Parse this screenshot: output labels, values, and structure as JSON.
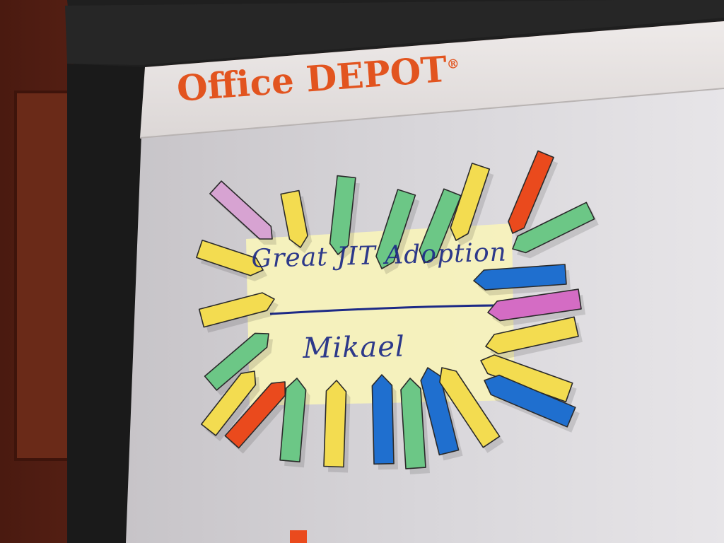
{
  "flipchart": {
    "brand_name": "Office DEPOT",
    "brand_mark": "®",
    "brand_color": "#e2541f"
  },
  "note": {
    "title": "Great JIT Adoption",
    "name": "Mikael",
    "ink_color": "#1d2a86",
    "paper_color": "#f7f2bc"
  },
  "flag_colors": {
    "yellow": "#f3dc50",
    "green": "#6cc786",
    "blue": "#1f6fcf",
    "pink": "#d46cc4",
    "red": "#ea4a1d",
    "lilac": "#d7a3d2"
  }
}
